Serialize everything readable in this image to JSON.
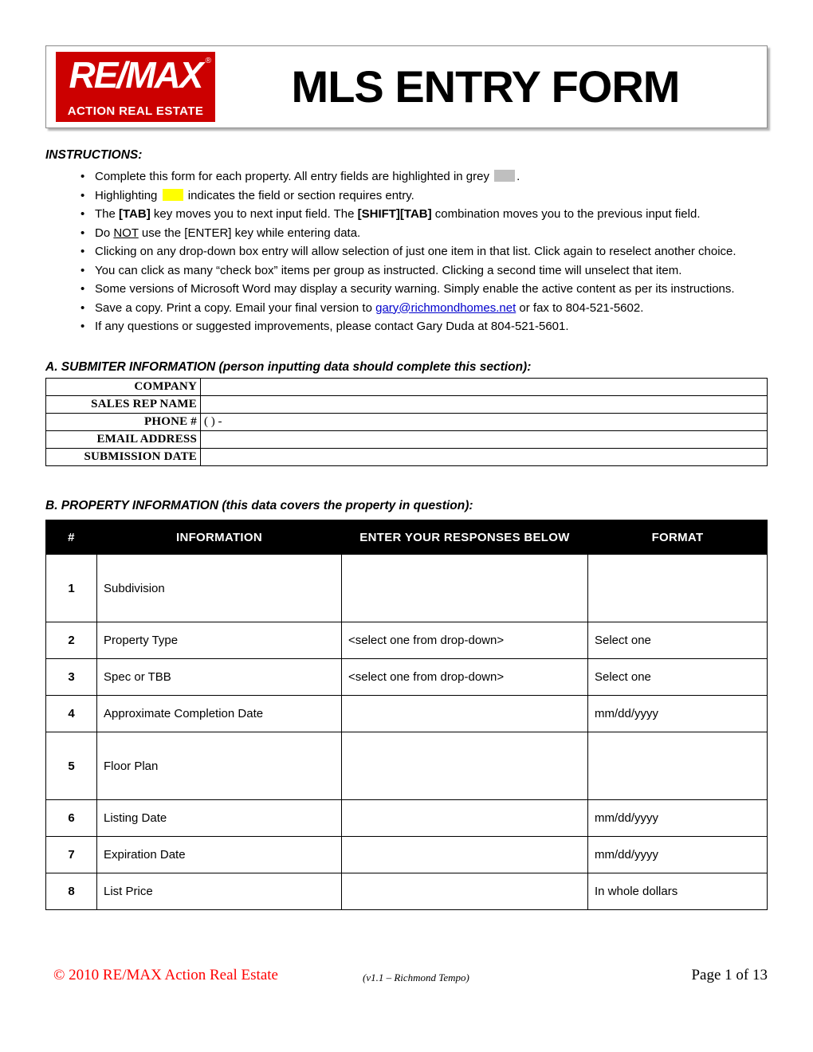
{
  "header": {
    "logo": {
      "brand": "RE/MAX",
      "registered_mark": "®",
      "tagline": "ACTION REAL ESTATE"
    },
    "title": "MLS ENTRY FORM"
  },
  "instructions": {
    "heading": "INSTRUCTIONS:",
    "bullet_glyph": "•",
    "items": [
      {
        "id": "grey-fields",
        "parts": [
          {
            "type": "text",
            "text": "Complete this form for each property.  All entry fields are highlighted in grey "
          },
          {
            "type": "swatch",
            "color": "#BFBFBF"
          },
          {
            "type": "text",
            "text": "."
          }
        ]
      },
      {
        "id": "yellow-required",
        "parts": [
          {
            "type": "text",
            "text": "Highlighting "
          },
          {
            "type": "swatch",
            "color": "#FFFF00"
          },
          {
            "type": "text",
            "text": " indicates the field or section requires entry."
          }
        ]
      },
      {
        "id": "tab-key",
        "parts": [
          {
            "type": "text",
            "text": "The "
          },
          {
            "type": "bold",
            "text": "[TAB]"
          },
          {
            "type": "text",
            "text": " key moves you to next input field.  The "
          },
          {
            "type": "bold",
            "text": "[SHIFT][TAB]"
          },
          {
            "type": "text",
            "text": " combination moves you to the previous input field."
          }
        ]
      },
      {
        "id": "no-enter",
        "parts": [
          {
            "type": "text",
            "text": "Do "
          },
          {
            "type": "underline",
            "text": "NOT"
          },
          {
            "type": "text",
            "text": " use the [ENTER] key while entering data."
          }
        ]
      },
      {
        "id": "dropdown",
        "parts": [
          {
            "type": "text",
            "text": "Clicking on any drop-down box entry will allow selection of just one item in that list.  Click again to reselect another choice."
          }
        ]
      },
      {
        "id": "checkbox",
        "parts": [
          {
            "type": "text",
            "text": "You can click as many “check box” items per group as instructed.  Clicking a second time will unselect that item."
          }
        ]
      },
      {
        "id": "security-warning",
        "parts": [
          {
            "type": "text",
            "text": "Some versions of Microsoft Word may display a security warning.  Simply enable the active content as per its instructions."
          }
        ]
      },
      {
        "id": "save-email",
        "parts": [
          {
            "type": "text",
            "text": "Save a copy.  Print a copy.  Email your final version to "
          },
          {
            "type": "link",
            "text": "gary@richmondhomes.net"
          },
          {
            "type": "text",
            "text": " or fax to 804-521-5602."
          }
        ]
      },
      {
        "id": "questions",
        "parts": [
          {
            "type": "text",
            "text": "If any questions or suggested improvements, please contact Gary Duda at 804-521-5601."
          }
        ]
      }
    ]
  },
  "section_a": {
    "title": "A.  SUBMITER INFORMATION (person inputting data should complete this section):",
    "rows": [
      {
        "label": "COMPANY",
        "value": ""
      },
      {
        "label": "SALES REP NAME",
        "value": ""
      },
      {
        "label": "PHONE #",
        "value": "(    )      -"
      },
      {
        "label": "EMAIL ADDRESS",
        "value": ""
      },
      {
        "label": "SUBMISSION DATE",
        "value": ""
      }
    ]
  },
  "section_b": {
    "title": "B.  PROPERTY INFORMATION (this data covers the property in question):",
    "columns": [
      "#",
      "INFORMATION",
      "ENTER YOUR RESPONSES BELOW",
      "FORMAT"
    ],
    "rows": [
      {
        "num": "1",
        "information": "Subdivision",
        "response": "",
        "format": "",
        "tall": true
      },
      {
        "num": "2",
        "information": "Property Type",
        "response": "<select one from drop-down>",
        "format": "Select one",
        "tall": false
      },
      {
        "num": "3",
        "information": "Spec or TBB",
        "response": "<select one from drop-down>",
        "format": "Select one",
        "tall": false
      },
      {
        "num": "4",
        "information": "Approximate Completion Date",
        "response": "",
        "format": "mm/dd/yyyy",
        "tall": false
      },
      {
        "num": "5",
        "information": "Floor Plan",
        "response": "",
        "format": "",
        "tall": true
      },
      {
        "num": "6",
        "information": "Listing Date",
        "response": "",
        "format": "mm/dd/yyyy",
        "tall": false
      },
      {
        "num": "7",
        "information": "Expiration Date",
        "response": "",
        "format": "mm/dd/yyyy",
        "tall": false
      },
      {
        "num": "8",
        "information": "List Price",
        "response": "",
        "format": "In whole dollars",
        "tall": false
      }
    ]
  },
  "footer": {
    "copyright": "© 2010 RE/MAX Action Real Estate",
    "version": "(v1.1 – Richmond Tempo)",
    "page": "Page 1 of 13"
  },
  "colors": {
    "brand_red": "#CC0000",
    "footer_red": "#FF0000",
    "highlight_grey": "#BFBFBF",
    "highlight_yellow": "#FFFF00",
    "link_blue": "#0000CC",
    "header_band": "#000000"
  }
}
